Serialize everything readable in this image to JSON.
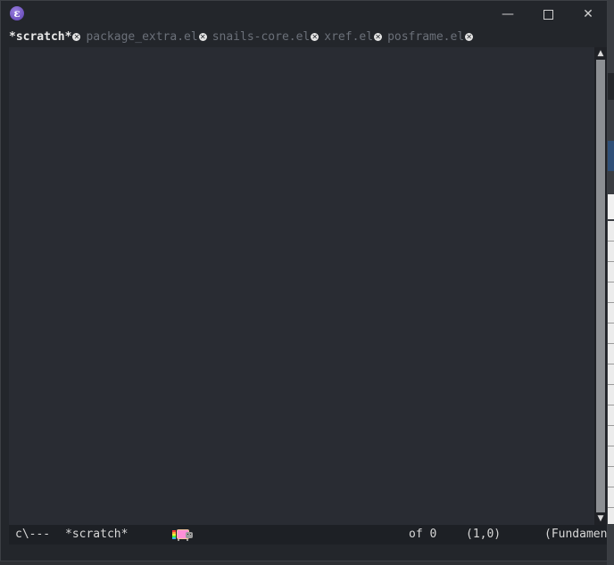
{
  "window": {
    "app_icon_glyph": "ε",
    "minimize_glyph": "—",
    "close_glyph": "✕"
  },
  "tabs": [
    {
      "label": "*scratch*",
      "active": true
    },
    {
      "label": "package_extra.el",
      "active": false
    },
    {
      "label": "snails-core.el",
      "active": false
    },
    {
      "label": "xref.el",
      "active": false
    },
    {
      "label": "posframe.el",
      "active": false
    }
  ],
  "tab_close_glyph": "✕",
  "scrollbar": {
    "up_glyph": "▲",
    "down_glyph": "▼"
  },
  "modeline": {
    "state": "c\\---",
    "buffer": "*scratch*",
    "position": "of 0",
    "coordinates": "(1,0)",
    "major_mode": "(Fundamental"
  },
  "icons": {
    "app": "emacs-icon",
    "nyan": "nyan-cat-icon"
  },
  "colors": {
    "background": "#292c33",
    "tab_active": "#e8e8e8",
    "tab_inactive": "#6b7079",
    "modeline_bg": "#1d2025"
  }
}
